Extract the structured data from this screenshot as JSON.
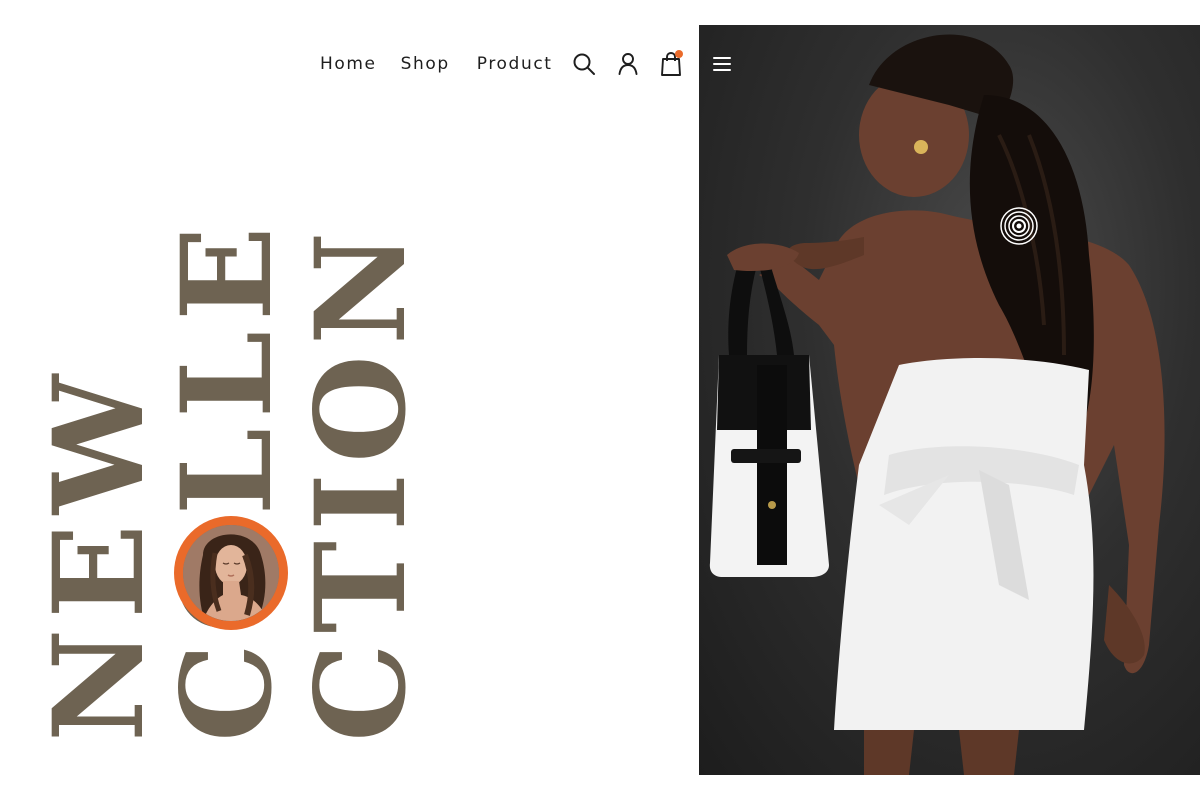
{
  "nav": {
    "items": [
      {
        "label": "Home"
      },
      {
        "label": "Shop"
      },
      {
        "label": "Product"
      }
    ],
    "icons": [
      "search-icon",
      "user-icon",
      "shopping-bag-icon"
    ],
    "cart_indicator_color": "#ea6a2a"
  },
  "hero": {
    "headline_lines": [
      "NEW",
      "COLLE",
      "CTION"
    ],
    "headline_color": "#6e6352",
    "accent_color": "#ea6a2a",
    "photo_panel_icons": [
      "menu-icon",
      "target-icon"
    ]
  }
}
